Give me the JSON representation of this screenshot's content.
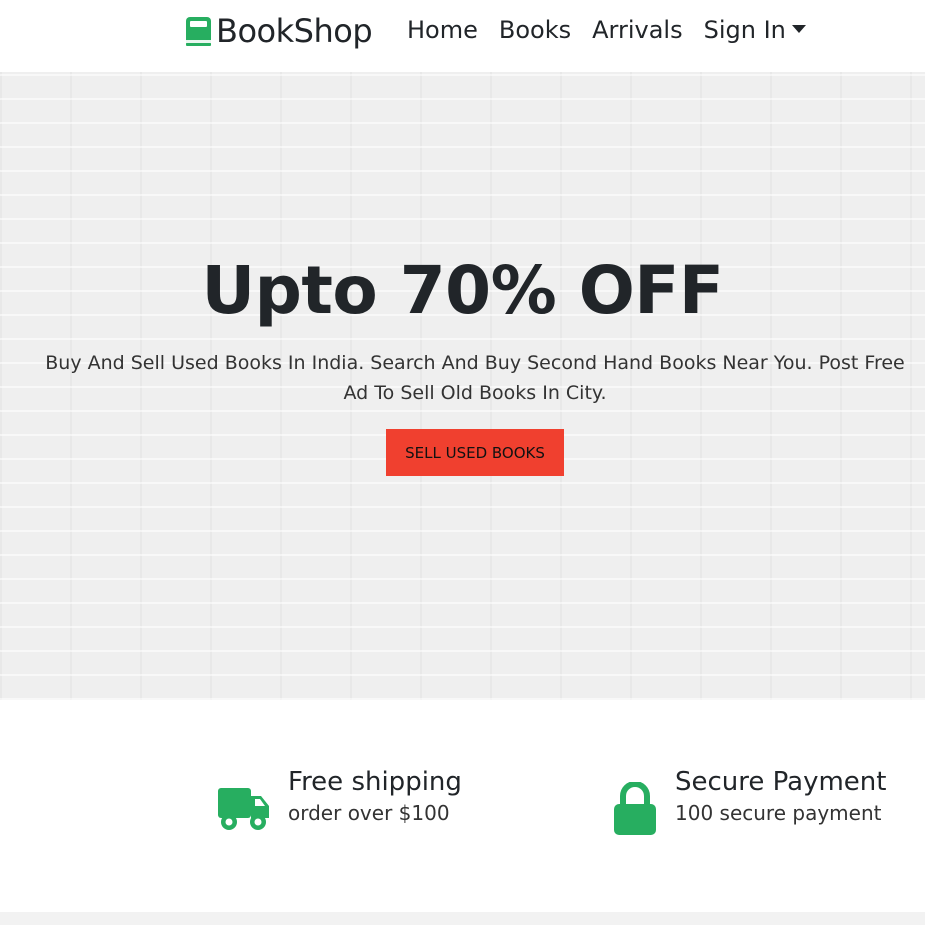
{
  "navbar": {
    "brand": "BookShop",
    "links": [
      {
        "label": "Home"
      },
      {
        "label": "Books"
      },
      {
        "label": "Arrivals"
      },
      {
        "label": "Sign In"
      }
    ]
  },
  "hero": {
    "title": "Upto 70% OFF",
    "subtitle": "Buy And Sell Used Books In India. Search And Buy Second Hand Books Near You. Post Free Ad To Sell Old Books In City.",
    "button_label": "SELL USED BOOKS"
  },
  "features": [
    {
      "title": "Free shipping",
      "desc": "order over $100",
      "icon": "truck-icon"
    },
    {
      "title": "Secure Payment",
      "desc": "100 secure payment",
      "icon": "lock-icon"
    }
  ],
  "colors": {
    "accent_green": "#27ae60",
    "button_red": "#f0402f"
  }
}
